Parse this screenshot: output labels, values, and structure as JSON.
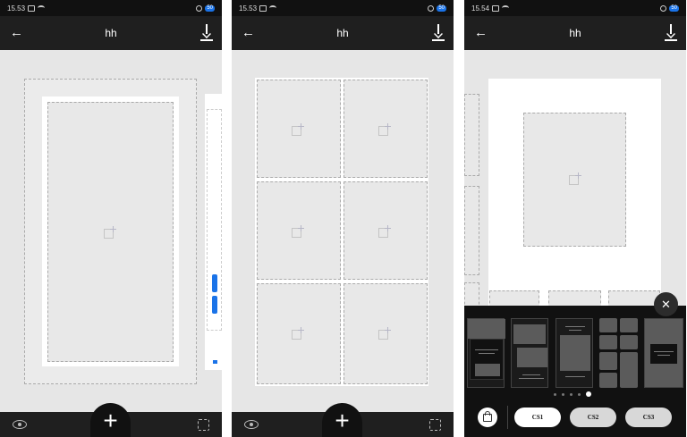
{
  "phones": [
    {
      "time": "15.53",
      "title": "hh",
      "battery": "50"
    },
    {
      "time": "15.53",
      "title": "hh",
      "battery": "50"
    },
    {
      "time": "15.54",
      "title": "hh",
      "battery": "50"
    }
  ],
  "icons": {
    "back": "arrow-left-icon",
    "download": "download-icon",
    "preview": "eye-icon",
    "add": "plus-icon",
    "focus": "focus-frame-icon",
    "close": "close-icon",
    "shop": "shopping-bag-icon"
  },
  "fab_label": "+",
  "close_label": "✕",
  "back_label": "←",
  "styles": [
    "CS1",
    "CS2",
    "CS3"
  ],
  "pagination": {
    "count": 5,
    "active": 5
  },
  "colors": {
    "bar": "#1f1f1f",
    "canvas": "#e6e6e6",
    "accent": "#1a73e8"
  }
}
